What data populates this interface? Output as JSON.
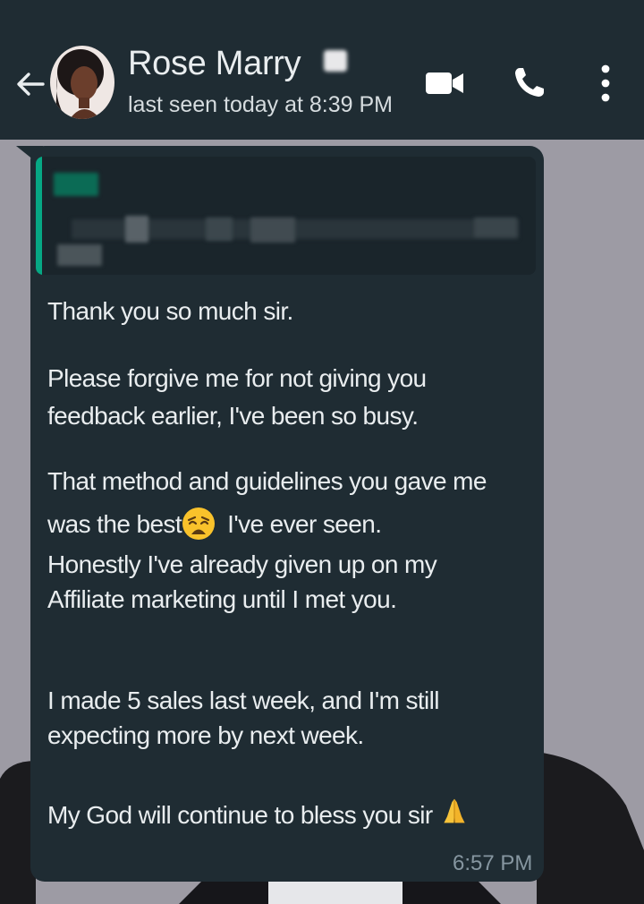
{
  "header": {
    "contact_name": "Rose Marry",
    "status": "last seen today at 8:39 PM",
    "icons": [
      "back-arrow-icon",
      "video-call-icon",
      "voice-call-icon",
      "more-options-icon"
    ]
  },
  "message": {
    "lines": {
      "p1": "Thank you so much sir.",
      "p2a": "Please forgive me for not giving you",
      "p2b": "feedback earlier, I've been so busy.",
      "p3a": "That method and guidelines you gave me",
      "p3b_pre": "was the best",
      "p3b_post": " I've ever seen.",
      "p3c": "Honestly I've already given up on my",
      "p3d": "Affiliate marketing until I met you.",
      "p4a": "I made 5 sales last week,  and I'm still",
      "p4b": "expecting more by next week.",
      "p5": "My God will continue to bless you sir "
    },
    "emojis": [
      "weary-face-emoji",
      "folded-hands-emoji"
    ],
    "time": "6:57 PM"
  },
  "colors": {
    "header_bg": "#1f2c33",
    "bubble_bg": "#1f2c33",
    "quote_bar": "#06a884",
    "text": "#e9edef",
    "meta_text": "#8696a0",
    "wallpaper": "#9d9ba4"
  }
}
